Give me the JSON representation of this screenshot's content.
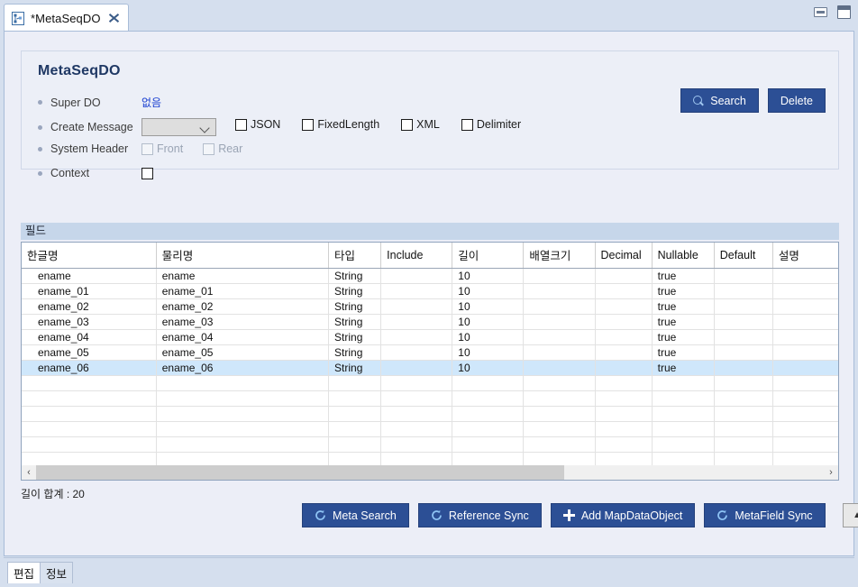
{
  "window": {
    "tab": {
      "title": "*MetaSeqDO",
      "icon": "hierarchy-icon",
      "close_icon": "close-icon"
    },
    "controls": {
      "minimize": "minimize-icon",
      "maximize": "maximize-icon"
    }
  },
  "form": {
    "title": "MetaSeqDO",
    "rows": {
      "super_do": {
        "label": "Super DO",
        "value": "없음"
      },
      "create_message": {
        "label": "Create Message",
        "selected": ""
      },
      "system_header": {
        "label": "System Header"
      },
      "context": {
        "label": "Context"
      }
    },
    "message_formats": [
      {
        "label": "JSON",
        "checked": false
      },
      {
        "label": "FixedLength",
        "checked": false
      },
      {
        "label": "XML",
        "checked": false
      },
      {
        "label": "Delimiter",
        "checked": false
      }
    ],
    "header_options": [
      {
        "label": "Front",
        "checked": false,
        "disabled": true
      },
      {
        "label": "Rear",
        "checked": false,
        "disabled": true
      }
    ],
    "buttons": {
      "search": "Search",
      "delete": "Delete"
    }
  },
  "field_section": {
    "band_label": "필드",
    "columns": [
      "한글명",
      "물리명",
      "타입",
      "Include",
      "길이",
      "배열크기",
      "Decimal",
      "Nullable",
      "Default",
      "설명"
    ],
    "rows": [
      {
        "한글명": "ename",
        "물리명": "ename",
        "타입": "String",
        "Include": "",
        "길이": "10",
        "배열크기": "",
        "Decimal": "",
        "Nullable": "true",
        "Default": "",
        "설명": "",
        "selected": false
      },
      {
        "한글명": "ename_01",
        "물리명": "ename_01",
        "타입": "String",
        "Include": "",
        "길이": "10",
        "배열크기": "",
        "Decimal": "",
        "Nullable": "true",
        "Default": "",
        "설명": "",
        "selected": false
      },
      {
        "한글명": "ename_02",
        "물리명": "ename_02",
        "타입": "String",
        "Include": "",
        "길이": "10",
        "배열크기": "",
        "Decimal": "",
        "Nullable": "true",
        "Default": "",
        "설명": "",
        "selected": false
      },
      {
        "한글명": "ename_03",
        "물리명": "ename_03",
        "타입": "String",
        "Include": "",
        "길이": "10",
        "배열크기": "",
        "Decimal": "",
        "Nullable": "true",
        "Default": "",
        "설명": "",
        "selected": false
      },
      {
        "한글명": "ename_04",
        "물리명": "ename_04",
        "타입": "String",
        "Include": "",
        "길이": "10",
        "배열크기": "",
        "Decimal": "",
        "Nullable": "true",
        "Default": "",
        "설명": "",
        "selected": false
      },
      {
        "한글명": "ename_05",
        "물리명": "ename_05",
        "타입": "String",
        "Include": "",
        "길이": "10",
        "배열크기": "",
        "Decimal": "",
        "Nullable": "true",
        "Default": "",
        "설명": "",
        "selected": false
      },
      {
        "한글명": "ename_06",
        "물리명": "ename_06",
        "타입": "String",
        "Include": "",
        "길이": "10",
        "배열크기": "",
        "Decimal": "",
        "Nullable": "true",
        "Default": "",
        "설명": "",
        "selected": true
      }
    ],
    "empty_row_count": 7,
    "scroll": {
      "left_arrow": "‹",
      "right_arrow": "›",
      "thumb_percent": 67
    },
    "summary": "길이 합계 : 20"
  },
  "actions": [
    {
      "label": "Meta Search",
      "icon": "refresh-icon"
    },
    {
      "label": "Reference Sync",
      "icon": "refresh-icon"
    },
    {
      "label": "Add MapDataObject",
      "icon": "plus-icon"
    },
    {
      "label": "MetaField Sync",
      "icon": "refresh-icon"
    }
  ],
  "move_buttons": {
    "up": "▲",
    "down": "▼"
  },
  "bottom_tabs": [
    {
      "label": "편집",
      "active": true
    },
    {
      "label": "정보",
      "active": false
    }
  ],
  "colors": {
    "primary_button": "#2c4f95",
    "link": "#1a3fd0",
    "title": "#1f3864",
    "band": "#c6d6ea",
    "selection": "#cfe7fb",
    "window_bg": "#d5dfee"
  }
}
